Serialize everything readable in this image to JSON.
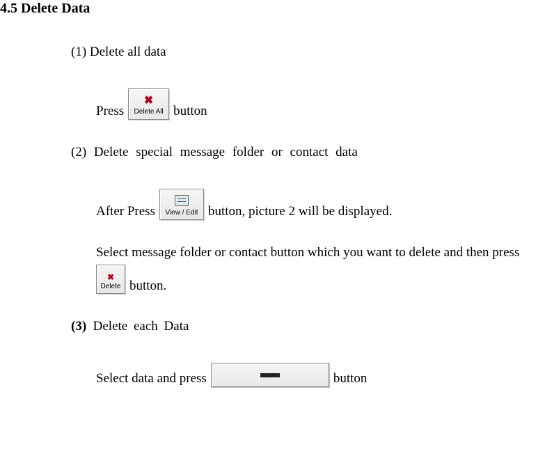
{
  "heading": "4.5 Delete Data",
  "item1": {
    "label": "(1) Delete all data",
    "line_pre": "Press",
    "button_caption": "Delete All",
    "line_post": "button"
  },
  "item2": {
    "label": "(2)  Delete  special  message  folder  or  contact  data",
    "line1_pre": "After Press",
    "view_edit_caption": "View / Edit",
    "line1_post": "button, picture 2 will be displayed.",
    "line2_pre": "Select message folder or contact button which you want to delete and then press",
    "delete_caption": "Delete",
    "line2_post": "button."
  },
  "item3": {
    "label_prefix": "(3)",
    "label_text": "Delete  each  Data",
    "line_pre": "Select data and press",
    "line_post": "button"
  }
}
